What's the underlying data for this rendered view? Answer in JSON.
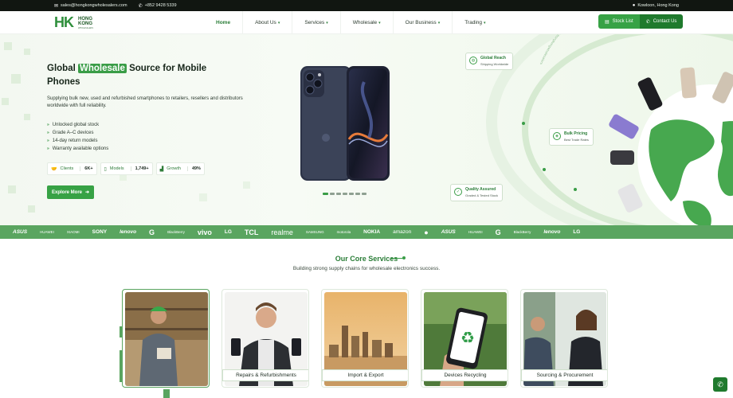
{
  "topbar": {
    "email_icon": "mail-icon",
    "email": "sales@hongkongwholesalers.com",
    "phone_icon": "phone-icon",
    "phone": "+852 9428 5339",
    "location_icon": "location-pin-icon",
    "location": "Kowloon, Hong Kong"
  },
  "logo": {
    "mark": "HK",
    "line1": "HONG",
    "line2": "KONG",
    "line3": "WHOLESALERS"
  },
  "nav": {
    "items": [
      {
        "label": "Home",
        "active": true,
        "dropdown": false
      },
      {
        "label": "About Us",
        "active": false,
        "dropdown": true
      },
      {
        "label": "Services",
        "active": false,
        "dropdown": true
      },
      {
        "label": "Wholesale",
        "active": false,
        "dropdown": true
      },
      {
        "label": "Our Business",
        "active": false,
        "dropdown": true
      },
      {
        "label": "Trading",
        "active": false,
        "dropdown": true
      }
    ],
    "stock_list": "Stock List",
    "contact_us": "Contact Us"
  },
  "hero": {
    "title_pre": "Global ",
    "title_highlight": "Wholesale",
    "title_post": " Source for Mobile Phones",
    "subtitle": "Supplying bulk new, used and refurbished smartphones to retailers, resellers and distributors worldwide with full reliability.",
    "features": [
      "Unlocked global stock",
      "Grade A–C devices",
      "14-day return models",
      "Warranty available options"
    ],
    "stats": [
      {
        "icon": "handshake-icon",
        "label": "Clients",
        "value": "6K+"
      },
      {
        "icon": "phone-icon",
        "label": "Models",
        "value": "1,749+"
      },
      {
        "icon": "growth-chart-icon",
        "label": "Growth",
        "value": "49%"
      }
    ],
    "cta": "Explore More",
    "slider": {
      "count": 7,
      "active": 1
    }
  },
  "badges": [
    {
      "title": "Global Reach",
      "subtitle": "Shipping Worldwide",
      "icon": "globe-icon"
    },
    {
      "title": "Bulk Pricing",
      "subtitle": "Best Trade Rates",
      "icon": "tag-icon"
    },
    {
      "title": "Quality Assured",
      "subtitle": "Graded & Tested Stock",
      "icon": "shield-check-icon"
    }
  ],
  "ring_text": "hongkongwholesalers",
  "brands": [
    "ASUS",
    "HUAWEI",
    "XIAOMI",
    "SONY",
    "lenovo",
    "G",
    "BlackBerry",
    "vivo",
    "LG",
    "TCL",
    "realme",
    "SAMSUNG",
    "motorola",
    "NOKIA",
    "amazon",
    "",
    "ASUS",
    "HUAWEI",
    "G",
    "BlackBerry",
    "lenovo",
    "LG"
  ],
  "services": {
    "title": "Our Core Services",
    "subtitle": "Building strong supply chains for wholesale electronics success.",
    "cards": [
      {
        "label": "",
        "image": "warehouse-worker-photo"
      },
      {
        "label": "Repairs & Refurbishments",
        "image": "man-holding-phones-photo"
      },
      {
        "label": "Import & Export",
        "image": "hong-kong-skyline-photo"
      },
      {
        "label": "Devices Recycling",
        "image": "recycling-phone-photo"
      },
      {
        "label": "Sourcing & Procurement",
        "image": "business-meeting-photo"
      }
    ]
  },
  "colors": {
    "brand_green": "#37a245",
    "dark_green": "#1f7a2d",
    "topbar": "#111611"
  }
}
